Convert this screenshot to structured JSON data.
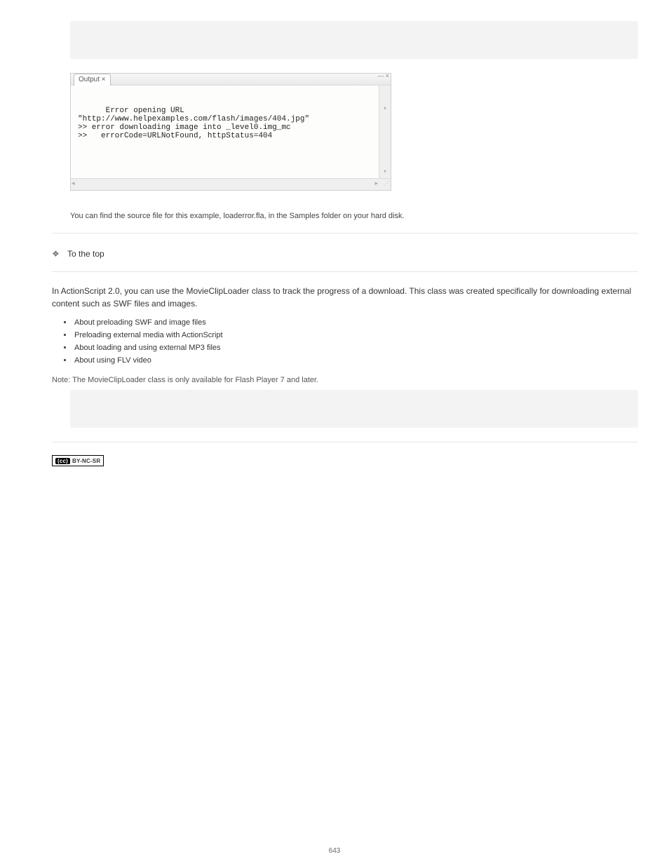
{
  "panel": {
    "tab_label": "Output ×",
    "titlebar_icons": "— ×",
    "lines": "Error opening URL\n\"http://www.helpexamples.com/flash/images/404.jpg\"\n>> error downloading image into _level0.img_mc\n>>   errorCode=URLNotFound, httpStatus=404"
  },
  "caption": "You can find the source file for this example, loaderror.fla, in the Samples folder on your hard disk.",
  "topic": "To the top",
  "para1": "In ActionScript 2.0, you can use the MovieClipLoader class to track the progress of a download. This class was created specifically for downloading external content such as SWF files and images.",
  "list": [
    "About preloading SWF and image files",
    "Preloading external media with ActionScript",
    "About loading and using external MP3 files",
    "About using FLV video"
  ],
  "note": "Note: The MovieClipLoader class is only available for Flash Player 7 and later.",
  "code2": "",
  "cc": {
    "badge_sym": "(cc)",
    "badge_text": "BY-NC-SR",
    "line": ""
  },
  "page_number": "643"
}
